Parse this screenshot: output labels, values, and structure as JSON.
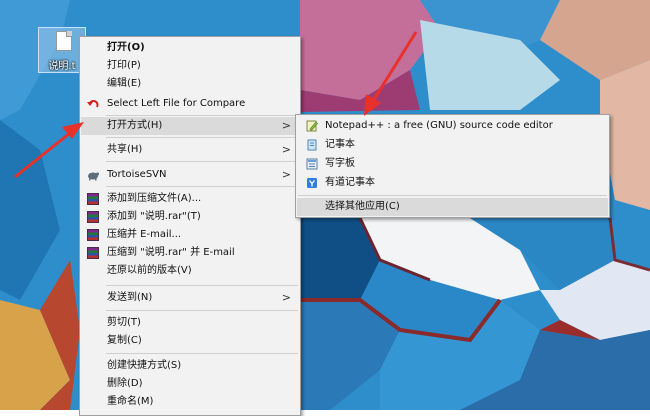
{
  "desktop": {
    "file_icon_label": "说明.t"
  },
  "context_menu": {
    "items": [
      {
        "label": "打开(O)",
        "bold": true
      },
      {
        "label": "打印(P)"
      },
      {
        "label": "编辑(E)"
      },
      {
        "label": "Select Left File for Compare",
        "icon": "compare-icon"
      },
      {
        "label": "打开方式(H)",
        "submenu": true,
        "highlighted": true
      },
      {
        "label": "共享(H)",
        "submenu": true
      },
      {
        "label": "TortoiseSVN",
        "icon": "tortoisesvn-icon",
        "submenu": true
      },
      {
        "label": "添加到压缩文件(A)...",
        "icon": "winrar-icon"
      },
      {
        "label": "添加到 \"说明.rar\"(T)",
        "icon": "winrar-icon"
      },
      {
        "label": "压缩并 E-mail...",
        "icon": "winrar-icon"
      },
      {
        "label": "压缩到 \"说明.rar\" 并 E-mail",
        "icon": "winrar-icon"
      },
      {
        "label": "还原以前的版本(V)"
      },
      {
        "label": "发送到(N)",
        "submenu": true
      },
      {
        "label": "剪切(T)"
      },
      {
        "label": "复制(C)"
      },
      {
        "label": "创建快捷方式(S)"
      },
      {
        "label": "删除(D)"
      },
      {
        "label": "重命名(M)"
      }
    ],
    "arrow_glyph": ">"
  },
  "open_with_submenu": {
    "items": [
      {
        "label": "Notepad++ : a free (GNU) source code editor",
        "icon": "notepad-plus-plus-icon"
      },
      {
        "label": "记事本",
        "icon": "notepad-icon"
      },
      {
        "label": "写字板",
        "icon": "wordpad-icon"
      },
      {
        "label": "有道记事本",
        "icon": "youdao-note-icon"
      },
      {
        "label": "选择其他应用(C)",
        "highlighted": true
      }
    ]
  },
  "colors": {
    "menu_background": "#f2f2f2",
    "menu_highlight": "#dadada",
    "annotation_arrow": "#e8312a"
  }
}
